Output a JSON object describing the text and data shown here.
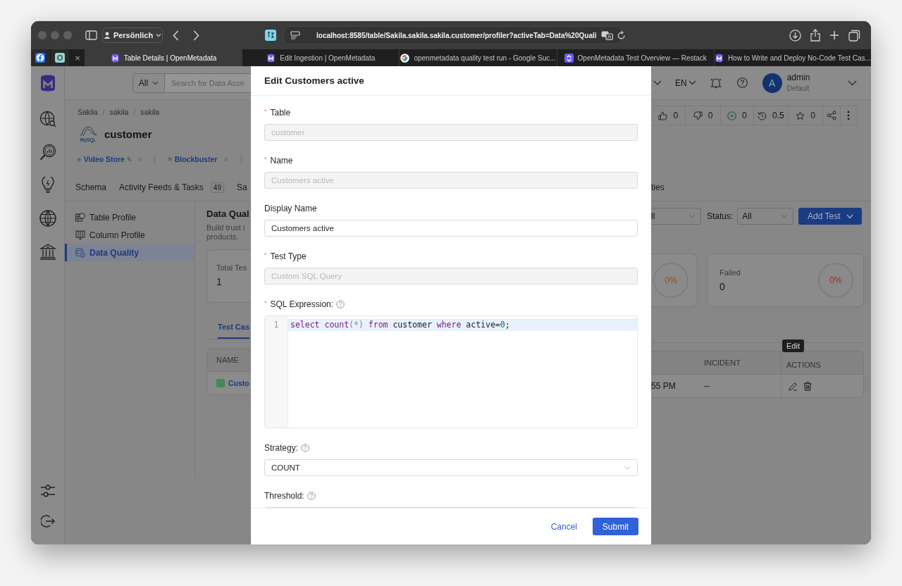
{
  "browser": {
    "profile": "Persönlich",
    "url": "localhost:8585/table/Sakila.sakila.sakila.customer/profiler?activeTab=Data%20Quali",
    "pinned_tabs": [
      {
        "kind": "facebook"
      },
      {
        "kind": "letter",
        "letter": "O"
      }
    ],
    "close_glyph": "×",
    "tabs": [
      {
        "title": "Table Details | OpenMetadata",
        "kind": "openmetadata",
        "selected": true
      },
      {
        "title": "Edit Ingestion | OpenMetadata",
        "kind": "openmetadata",
        "selected": false
      },
      {
        "title": "openmetadata quality test run - Google Suc...",
        "kind": "google",
        "selected": false
      },
      {
        "title": "OpenMetadata Test Overview — Restack",
        "kind": "restack",
        "selected": false
      },
      {
        "title": "How to Write and Deploy No-Code Test Cas...",
        "kind": "openmetadata",
        "selected": false
      }
    ]
  },
  "app": {
    "search": {
      "scope": "All",
      "placeholder": "Search for Data Asse"
    },
    "language": "EN",
    "user": {
      "initial": "A",
      "name": "admin",
      "role": "Default"
    },
    "breadcrumb": [
      {
        "kind": "crumb",
        "text": "Sakila"
      },
      {
        "kind": "separator",
        "text": "/"
      },
      {
        "kind": "crumb",
        "text": "sakila"
      },
      {
        "kind": "separator",
        "text": "/"
      },
      {
        "kind": "crumb",
        "text": "sakila"
      }
    ],
    "entity": {
      "name": "customer",
      "logo_text": "MySQL",
      "domain": "Video Store",
      "owner": "Blockbuster"
    },
    "votes": [
      {
        "kind": "up",
        "count": "0"
      },
      {
        "kind": "down",
        "count": "0"
      },
      {
        "kind": "status",
        "count": "0"
      },
      {
        "kind": "version",
        "count": "0.5"
      },
      {
        "kind": "star",
        "count": "0"
      }
    ],
    "tabs": [
      {
        "label": "Schema",
        "selected": false
      },
      {
        "label": "Activity Feeds & Tasks",
        "badge": "49",
        "selected": false
      },
      {
        "label": "Sa",
        "selected": false
      }
    ],
    "tabs_right": [
      {
        "label": "ties",
        "selected": false
      }
    ],
    "profile_nav": [
      {
        "label": "Table Profile",
        "kind": "table",
        "selected": false
      },
      {
        "label": "Column Profile",
        "kind": "column",
        "selected": false
      },
      {
        "label": "Data Quality",
        "kind": "quality",
        "selected": true
      }
    ],
    "data_quality": {
      "title": "Data Qual",
      "description_lines": [
        "Build trust i",
        "products."
      ]
    },
    "filters": {
      "type_value": "ll",
      "status_label": "Status:",
      "status_value": "All",
      "add_button": "Add Test"
    },
    "summary": [
      {
        "label": "Total Tes",
        "value": "1"
      },
      {
        "percent": "0%",
        "color": "#80590c"
      },
      {
        "label": "Failed",
        "value": "0",
        "percent": "0%",
        "color": "#9c2a22"
      }
    ],
    "results_tab": {
      "label": "Test Cas",
      "selected": true
    },
    "table": {
      "name_column": "NAME",
      "right_columns": [
        "INCIDENT",
        "ACTIONS"
      ],
      "row": {
        "name": "Custo",
        "color": "#3c8a5e",
        "time": "55 PM",
        "incident": "--"
      }
    },
    "tooltip": "Edit"
  },
  "modal": {
    "title": "Edit Customers active",
    "fields": [
      {
        "label": "Table",
        "mark": "*",
        "kind": "input",
        "value": "customer",
        "disabled": true
      },
      {
        "label": "Name",
        "mark": "*",
        "kind": "input",
        "value": "Customers active",
        "disabled": true
      },
      {
        "label": "Display Name",
        "kind": "input",
        "value": "Customers active",
        "disabled": false
      },
      {
        "label": "Test Type",
        "mark": "*",
        "kind": "input",
        "value": "Custom SQL Query",
        "disabled": true
      },
      {
        "label": "SQL Expression:",
        "mark": "*",
        "help": true,
        "kind": "code",
        "lines": [
          {
            "number": "1",
            "tokens": [
              {
                "text": "select ",
                "kind": "keyword"
              },
              {
                "text": "count",
                "kind": "keyword"
              },
              {
                "text": "(*) ",
                "kind": "punct"
              },
              {
                "text": "from ",
                "kind": "keyword"
              },
              {
                "text": "customer ",
                "kind": "plain"
              },
              {
                "text": "where ",
                "kind": "keyword"
              },
              {
                "text": "active=",
                "kind": "plain"
              },
              {
                "text": "0",
                "kind": "number"
              },
              {
                "text": ";",
                "kind": "plain"
              }
            ]
          }
        ]
      },
      {
        "label": "Strategy:",
        "help": true,
        "kind": "select",
        "value": "COUNT",
        "disabled": false
      },
      {
        "label": "Threshold:",
        "help": true,
        "kind": "input"
      }
    ],
    "cancel": "Cancel",
    "submit": "Submit"
  }
}
